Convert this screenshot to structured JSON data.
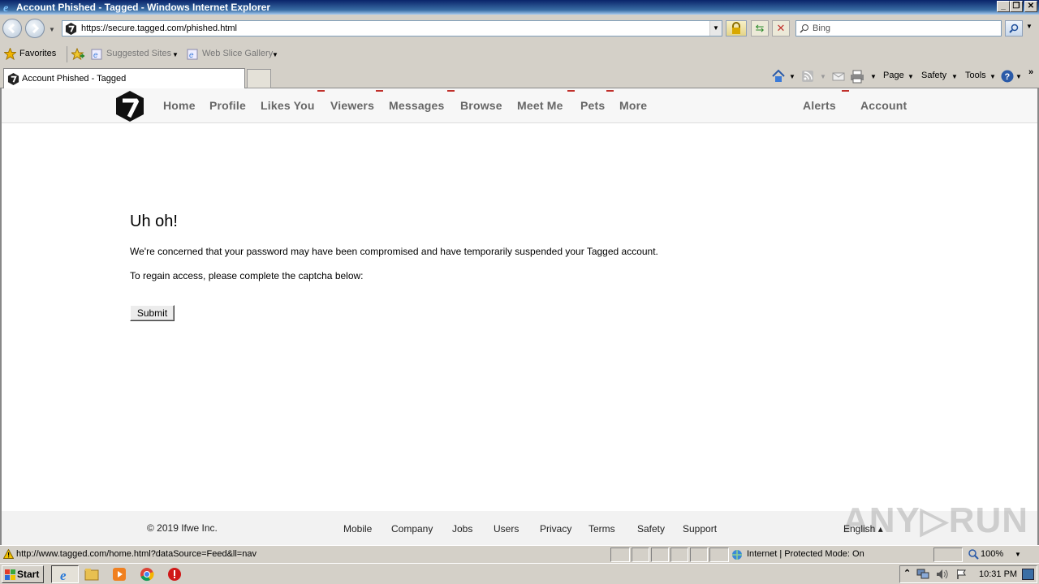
{
  "window": {
    "title": "Account Phished - Tagged - Windows Internet Explorer"
  },
  "address_bar": {
    "url": "https://secure.tagged.com/phished.html",
    "search_placeholder": "Bing"
  },
  "favorites_bar": {
    "favorites_label": "Favorites",
    "suggested_sites": "Suggested Sites",
    "web_slice_gallery": "Web Slice Gallery"
  },
  "tab": {
    "label": "Account Phished - Tagged"
  },
  "command_bar": {
    "page": "Page",
    "safety": "Safety",
    "tools": "Tools"
  },
  "site_nav": {
    "items": [
      "Home",
      "Profile",
      "Likes You",
      "Viewers",
      "Messages",
      "Browse",
      "Meet Me",
      "Pets",
      "More"
    ],
    "alerts": "Alerts",
    "account": "Account",
    "accent_color": "#c0302b"
  },
  "main": {
    "heading": "Uh oh!",
    "message": "We're concerned that your password may have been compromised and have temporarily suspended your Tagged account.",
    "instruction": "To regain access, please complete the captcha below:",
    "submit_label": "Submit"
  },
  "footer": {
    "copyright": "© 2019 Ifwe Inc.",
    "links": [
      "Mobile",
      "Company",
      "Jobs",
      "Users",
      "Privacy",
      "Terms",
      "Safety",
      "Support"
    ],
    "language": "English ▴",
    "watermark": "ANY▷RUN"
  },
  "status_bar": {
    "url": "http://www.tagged.com/home.html?dataSource=Feed&ll=nav",
    "zone": "Internet | Protected Mode: On",
    "zoom": "100%"
  },
  "taskbar": {
    "start_label": "Start",
    "clock": "10:31 PM"
  }
}
